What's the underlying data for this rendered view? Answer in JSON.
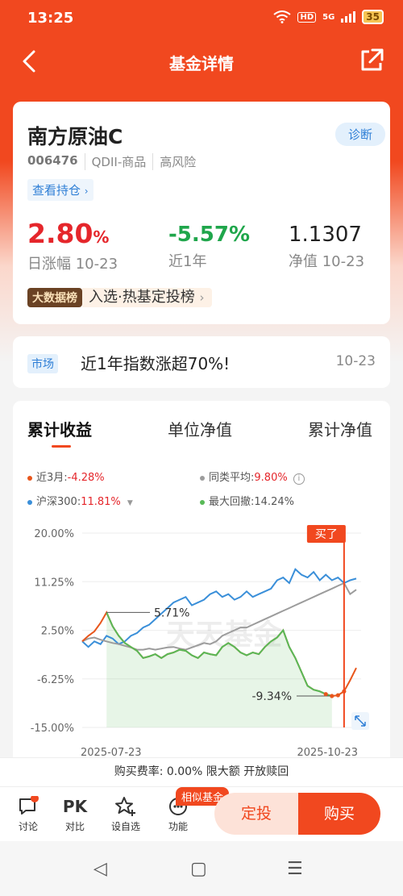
{
  "status": {
    "time": "13:25",
    "hd": "HD",
    "signal": "5G",
    "battery": "35"
  },
  "nav": {
    "title": "基金详情"
  },
  "fund": {
    "name": "南方原油C",
    "diagnose": "诊断",
    "code": "006476",
    "type": "QDII-商品",
    "risk": "高风险",
    "holdings": "查看持仓",
    "day_change": "2.80",
    "day_change_unit": "%",
    "day_change_label": "日涨幅 10-23",
    "year_change": "-5.57%",
    "year_change_label": "近1年",
    "nav_value": "1.1307",
    "nav_label": "净值 10-23",
    "bigdata_tag": "大数据榜",
    "bigdata_text": "入选·热基定投榜"
  },
  "market": {
    "tag": "市场",
    "text": "近1年指数涨超70%!",
    "date": "10-23"
  },
  "chart_tabs": [
    "累计收益",
    "单位净值",
    "累计净值"
  ],
  "legend": {
    "l1_label": "近3月:",
    "l1_value": "-4.28%",
    "l2_label": "同类平均:",
    "l2_value": "9.80%",
    "l3_label": "沪深300:",
    "l3_value": "11.81%",
    "l4_label": "最大回撤:",
    "l4_value": "14.24%"
  },
  "colors": {
    "accent": "#f1481f",
    "fund": "#e8561c",
    "peer": "#9c9c9c",
    "hs300": "#3a8fd9",
    "drawdown": "#58b957"
  },
  "chart_data": {
    "type": "line",
    "yticks": [
      "20.00%",
      "11.25%",
      "2.50%",
      "-6.25%",
      "-15.00%"
    ],
    "ylim": [
      -15,
      20
    ],
    "xticks": [
      "2025-07-23",
      "2025-10-23"
    ],
    "series": [
      {
        "name": "近3月",
        "values": [
          0.5,
          1.5,
          2.3,
          3.8,
          5.71,
          3.2,
          1.5,
          0.2,
          -0.5,
          -1.2,
          -2.5,
          -2.2,
          -1.8,
          -2.5,
          -1.8,
          -1.5,
          -1.0,
          -1.2,
          -2.0,
          -2.5,
          -1.5,
          -1.8,
          -2.0,
          -0.5,
          0.2,
          -0.5,
          -1.5,
          -2.0,
          -1.5,
          -1.8,
          -0.5,
          0.5,
          1.2,
          2.5,
          -0.5,
          -2.5,
          -5.0,
          -7.5,
          -8.2,
          -8.5,
          -9.0,
          -9.34,
          -9.2,
          -8.5,
          -6.5,
          -4.28
        ]
      },
      {
        "name": "同类平均",
        "values": [
          0.5,
          1.0,
          1.2,
          0.8,
          0.5,
          0.2,
          0.0,
          -0.3,
          -0.6,
          -1.0,
          -1.0,
          -0.8,
          -1.0,
          -0.8,
          -0.6,
          -0.5,
          -0.8,
          -1.0,
          -0.6,
          -0.2,
          0.2,
          0.0,
          0.5,
          1.5,
          2.0,
          2.5,
          3.0,
          3.0,
          3.5,
          4.0,
          4.5,
          5.0,
          5.5,
          6.0,
          6.5,
          7.0,
          7.5,
          8.0,
          8.5,
          9.0,
          9.5,
          10.0,
          10.5,
          11.0,
          9.0,
          9.8
        ]
      },
      {
        "name": "沪深300",
        "values": [
          0.5,
          -0.5,
          0.5,
          0.0,
          1.5,
          1.0,
          0.0,
          0.5,
          1.5,
          2.0,
          3.0,
          3.5,
          4.5,
          5.5,
          6.5,
          7.5,
          8.0,
          8.5,
          7.0,
          7.5,
          8.0,
          9.0,
          9.5,
          8.5,
          9.0,
          8.0,
          8.5,
          9.5,
          8.5,
          9.0,
          9.5,
          10.0,
          11.5,
          12.0,
          11.0,
          13.5,
          12.5,
          12.0,
          13.0,
          11.5,
          12.5,
          11.5,
          12.0,
          11.0,
          11.5,
          11.81
        ]
      }
    ],
    "markers": {
      "max_label": "5.71%",
      "min_label": "-9.34%",
      "bought_label": "买了"
    }
  },
  "watermark": "天天基金",
  "fee": {
    "text": "购买费率: 0.00% 限大额 开放赎回"
  },
  "bottom": {
    "discuss": "讨论",
    "pk_icon": "PK",
    "pk": "对比",
    "watch": "设自选",
    "func": "功能",
    "similar": "相似基金",
    "fixed": "定投",
    "buy": "购买"
  },
  "sysnav": {
    "back": "◁",
    "home": "▢",
    "menu": "☰"
  }
}
